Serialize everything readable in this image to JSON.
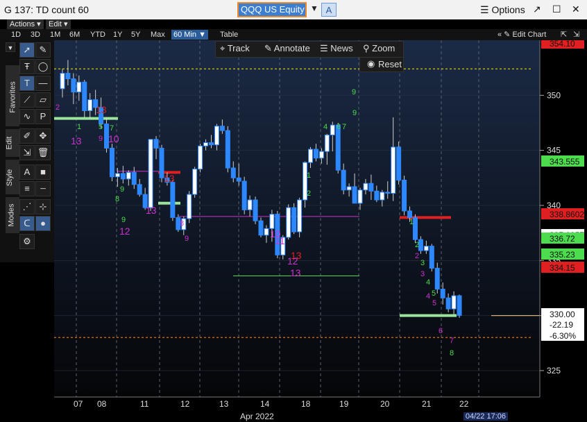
{
  "titlebar": {
    "window_title": "G 137: TD count 60",
    "ticker": "QQQ US Equity",
    "ticker_drop": "▼",
    "a_button": "A",
    "options_label": "☰ Options",
    "pop_icon": "↗",
    "max_icon": "☐",
    "close_icon": "✕"
  },
  "menubar": {
    "actions": "Actions ▾",
    "edit": "Edit ▾"
  },
  "rangebar": {
    "ranges": [
      "1D",
      "3D",
      "1M",
      "6M",
      "YTD",
      "1Y",
      "5Y",
      "Max"
    ],
    "interval": "60 Min ▼",
    "table": "Table",
    "edit_chart": "« ✎ Edit Chart",
    "collapse": "⇱",
    "detach": "⇲"
  },
  "sidetabs": [
    "Favorites",
    "Edit",
    "Style",
    "Modes"
  ],
  "overlay": {
    "track": "Track",
    "annotate": "Annotate",
    "news": "News",
    "zoom": "Zoom",
    "reset": "Reset"
  },
  "colors": {
    "up": "#2d88ff",
    "down": "#2d88ff",
    "green": "#4ddc4d",
    "red": "#e02020",
    "magenta": "#d030d0",
    "yellow": "#d8c800"
  },
  "chart_data": {
    "type": "line",
    "title": "",
    "x_ticks": [
      "07",
      "08",
      "11",
      "12",
      "13",
      "14",
      "18",
      "19",
      "20",
      "21",
      "22"
    ],
    "x_caption": "Apr 2022",
    "y_ticks": [
      325,
      330,
      335,
      340,
      345,
      350
    ],
    "ylim": [
      322.6,
      355
    ],
    "price_labels": [
      {
        "text": "354.10",
        "color": "#e02020"
      },
      {
        "text": "343.555",
        "color": "#4ddc4d"
      },
      {
        "text": "338.8602",
        "color": "#e02020"
      },
      {
        "text": "337.0957",
        "color": "#ffffff"
      },
      {
        "text": "336.72",
        "color": "#4ddc4d"
      },
      {
        "text": "335.23",
        "color": "#4ddc4d"
      },
      {
        "text": "334.15",
        "color": "#e02020"
      },
      {
        "text": "330.00",
        "color": "#000000"
      },
      {
        "text": "-22.19",
        "color": "#000000"
      },
      {
        "text": "-6.30%",
        "color": "#000000"
      }
    ],
    "candles": [
      [
        350.6,
        352.4,
        349.8,
        352.0
      ],
      [
        352,
        353.2,
        350.9,
        351.5
      ],
      [
        351.5,
        352.0,
        349.2,
        350.3
      ],
      [
        350.3,
        351.8,
        349.5,
        351.2
      ],
      [
        351.2,
        351.4,
        348.0,
        348.6
      ],
      [
        348.6,
        350.2,
        347.8,
        349.6
      ],
      [
        349.6,
        350.5,
        348.2,
        348.9
      ],
      [
        348.9,
        349.8,
        347.0,
        347.4
      ],
      [
        347.4,
        348.0,
        344.8,
        345.2
      ],
      [
        345.2,
        345.6,
        342.2,
        342.6
      ],
      [
        342.6,
        343.4,
        341.7,
        342.9
      ],
      [
        342.9,
        343.6,
        342.0,
        342.4
      ],
      [
        342.4,
        343.2,
        341.8,
        343.0
      ],
      [
        343.0,
        343.5,
        341.5,
        341.9
      ],
      [
        341.9,
        342.4,
        340.8,
        341.0
      ],
      [
        341.0,
        341.6,
        339.6,
        339.8
      ],
      [
        339.8,
        344.0,
        339.5,
        346.0
      ],
      [
        346.0,
        346.3,
        344.2,
        345.2
      ],
      [
        345.2,
        345.5,
        342.1,
        342.5
      ],
      [
        342.5,
        343.0,
        341.8,
        342.1
      ],
      [
        342.1,
        342.3,
        338.6,
        338.9
      ],
      [
        338.9,
        339.2,
        337.6,
        337.8
      ],
      [
        337.8,
        339.0,
        337.3,
        338.8
      ],
      [
        338.8,
        341.3,
        338.4,
        341.0
      ],
      [
        341.0,
        343.5,
        340.7,
        343.3
      ],
      [
        343.3,
        345.6,
        343.0,
        345.4
      ],
      [
        345.4,
        346.0,
        345.0,
        345.7
      ],
      [
        345.7,
        346.4,
        345.2,
        345.5
      ],
      [
        345.5,
        347.4,
        345.0,
        347.2
      ],
      [
        347.2,
        347.8,
        346.5,
        346.8
      ],
      [
        346.8,
        347.2,
        343.0,
        343.4
      ],
      [
        343.4,
        344.0,
        342.1,
        342.5
      ],
      [
        342.5,
        343.8,
        341.8,
        342.2
      ],
      [
        342.2,
        342.6,
        339.2,
        339.6
      ],
      [
        339.6,
        340.9,
        339.0,
        340.5
      ],
      [
        340.5,
        340.8,
        338.3,
        338.6
      ],
      [
        338.6,
        338.9,
        337.1,
        337.3
      ],
      [
        337.3,
        338.2,
        336.6,
        337.9
      ],
      [
        337.9,
        339.6,
        336.7,
        339.2
      ],
      [
        339.2,
        339.5,
        335.2,
        335.5
      ],
      [
        335.5,
        337.3,
        335.1,
        337.1
      ],
      [
        337.1,
        340.1,
        336.9,
        339.8
      ],
      [
        339.8,
        340.2,
        337.4,
        337.6
      ],
      [
        337.6,
        340.7,
        337.1,
        340.5
      ],
      [
        340.5,
        344.0,
        339.8,
        343.9
      ],
      [
        343.9,
        345.3,
        343.4,
        345.1
      ],
      [
        345.1,
        345.6,
        344.0,
        344.3
      ],
      [
        344.3,
        345.2,
        343.8,
        344.9
      ],
      [
        344.9,
        346.5,
        343.7,
        346.4
      ],
      [
        346.4,
        347.6,
        344.9,
        347.3
      ],
      [
        347.3,
        347.5,
        342.9,
        343.2
      ],
      [
        343.2,
        343.8,
        341.0,
        341.4
      ],
      [
        341.4,
        342.0,
        340.8,
        341.7
      ],
      [
        341.7,
        342.9,
        340.9,
        340.2
      ],
      [
        340.2,
        341.6,
        339.6,
        341.4
      ],
      [
        341.4,
        342.4,
        341.0,
        342.0
      ],
      [
        342.0,
        342.8,
        340.5,
        341.3
      ],
      [
        341.3,
        341.8,
        340.3,
        340.5
      ],
      [
        340.5,
        341.4,
        339.9,
        341.2
      ],
      [
        341.2,
        342.2,
        340.6,
        341.1
      ],
      [
        341.1,
        348.0,
        340.4,
        345.3
      ],
      [
        345.3,
        345.8,
        341.9,
        342.3
      ],
      [
        342.3,
        342.7,
        339.1,
        339.5
      ],
      [
        339.5,
        339.9,
        338.5,
        338.9
      ],
      [
        338.9,
        339.2,
        336.6,
        336.9
      ],
      [
        336.9,
        337.2,
        335.6,
        335.9
      ],
      [
        335.9,
        336.8,
        335.6,
        336.3
      ],
      [
        336.3,
        336.5,
        334.0,
        334.3
      ],
      [
        334.3,
        334.8,
        332.0,
        332.4
      ],
      [
        332.4,
        333.0,
        331.0,
        331.6
      ],
      [
        331.6,
        332.0,
        330.3,
        330.6
      ],
      [
        330.6,
        332.2,
        330.1,
        331.8
      ],
      [
        331.8,
        331.9,
        329.8,
        330.0
      ]
    ],
    "series": [],
    "td_counts": [
      {
        "text": "2",
        "color": "magenta",
        "x": 80,
        "y": 158
      },
      {
        "text": "13",
        "color": "red",
        "x": 138,
        "y": 163
      },
      {
        "text": "1",
        "color": "green",
        "x": 111,
        "y": 186
      },
      {
        "text": "5",
        "color": "green",
        "x": 142,
        "y": 186
      },
      {
        "text": "7",
        "color": "green",
        "x": 158,
        "y": 188
      },
      {
        "text": "13",
        "color": "magenta",
        "x": 102,
        "y": 208
      },
      {
        "text": "9",
        "color": "magenta",
        "x": 142,
        "y": 203
      },
      {
        "text": "10",
        "color": "magenta",
        "x": 156,
        "y": 205
      },
      {
        "text": "13",
        "color": "red",
        "x": 236,
        "y": 262
      },
      {
        "text": "9",
        "color": "green",
        "x": 173,
        "y": 276
      },
      {
        "text": "8",
        "color": "green",
        "x": 166,
        "y": 290
      },
      {
        "text": "9",
        "color": "green",
        "x": 175,
        "y": 320
      },
      {
        "text": "12",
        "color": "magenta",
        "x": 172,
        "y": 338
      },
      {
        "text": "13",
        "color": "magenta",
        "x": 210,
        "y": 308
      },
      {
        "text": "8",
        "color": "magenta",
        "x": 259,
        "y": 325
      },
      {
        "text": "9",
        "color": "magenta",
        "x": 266,
        "y": 347
      },
      {
        "text": "13",
        "color": "red",
        "x": 419,
        "y": 373
      },
      {
        "text": "13",
        "color": "magenta",
        "x": 418,
        "y": 398
      },
      {
        "text": "11",
        "color": "magenta",
        "x": 396,
        "y": 352
      },
      {
        "text": "10",
        "color": "magenta",
        "x": 389,
        "y": 342
      },
      {
        "text": "12",
        "color": "magenta",
        "x": 414,
        "y": 381
      },
      {
        "text": "9",
        "color": "green",
        "x": 507,
        "y": 136
      },
      {
        "text": "9",
        "color": "green",
        "x": 508,
        "y": 166
      },
      {
        "text": "4",
        "color": "green",
        "x": 466,
        "y": 186
      },
      {
        "text": "6",
        "color": "green",
        "x": 485,
        "y": 186
      },
      {
        "text": "7",
        "color": "green",
        "x": 493,
        "y": 186
      },
      {
        "text": "1",
        "color": "green",
        "x": 442,
        "y": 256
      },
      {
        "text": "2",
        "color": "green",
        "x": 442,
        "y": 282
      },
      {
        "text": "1",
        "color": "green",
        "x": 590,
        "y": 323
      },
      {
        "text": "2",
        "color": "green",
        "x": 598,
        "y": 356
      },
      {
        "text": "3",
        "color": "green",
        "x": 606,
        "y": 382
      },
      {
        "text": "4",
        "color": "green",
        "x": 614,
        "y": 410
      },
      {
        "text": "5",
        "color": "green",
        "x": 622,
        "y": 426
      },
      {
        "text": "2",
        "color": "magenta",
        "x": 598,
        "y": 372
      },
      {
        "text": "3",
        "color": "magenta",
        "x": 606,
        "y": 398
      },
      {
        "text": "4",
        "color": "magenta",
        "x": 614,
        "y": 430
      },
      {
        "text": "5",
        "color": "magenta",
        "x": 623,
        "y": 440
      },
      {
        "text": "6",
        "color": "magenta",
        "x": 632,
        "y": 480
      },
      {
        "text": "7",
        "color": "magenta",
        "x": 648,
        "y": 494
      },
      {
        "text": "8",
        "color": "green",
        "x": 648,
        "y": 512
      }
    ],
    "ref_lines": [
      {
        "label": "yellow-dotted-top",
        "color": "#d8c800",
        "y": 352.4,
        "x0": 0,
        "x1": 690
      },
      {
        "label": "orange-dotted-bottom",
        "color": "#c86a00",
        "y": 328.0,
        "x0": 0,
        "x1": 690
      },
      {
        "label": "white-solid-bottom",
        "color": "#d8b080",
        "y": 330.0,
        "x0": 630,
        "x1": 780
      }
    ],
    "date_label": "04/22 17:06"
  }
}
